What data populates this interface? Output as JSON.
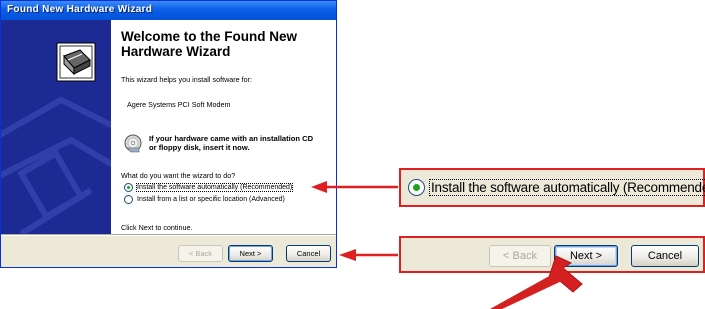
{
  "window": {
    "title": "Found New Hardware Wizard",
    "welcome_title": "Welcome to the Found New Hardware Wizard",
    "intro_text": "This wizard helps you install software for:",
    "device_name": "Agere Systems PCI Soft Modem",
    "cd_line1": "If your hardware came with an installation CD",
    "cd_line2": "or floppy disk, insert it now.",
    "question": "What do you want the wizard to do?",
    "options": [
      {
        "label": "Install the software automatically (Recommended)",
        "selected": true
      },
      {
        "label": "Install from a list or specific location (Advanced)",
        "selected": false
      }
    ],
    "continue_text": "Click Next to continue.",
    "buttons": {
      "back": "< Back",
      "next": "Next >",
      "cancel": "Cancel"
    }
  },
  "callout_option": {
    "label": "Install the software automatically (Recommended)",
    "selected": true
  },
  "callout_buttons": {
    "back": "< Back",
    "next": "Next >",
    "cancel": "Cancel"
  },
  "colors": {
    "titlebar": "#0a5ee8",
    "side_panel": "#1e2a94",
    "dialog_bg": "#ece9d8",
    "annotation_red": "#e02020"
  },
  "icons": [
    "hardware-wizard-icon",
    "cd-icon",
    "arrow-annotation-icon"
  ]
}
